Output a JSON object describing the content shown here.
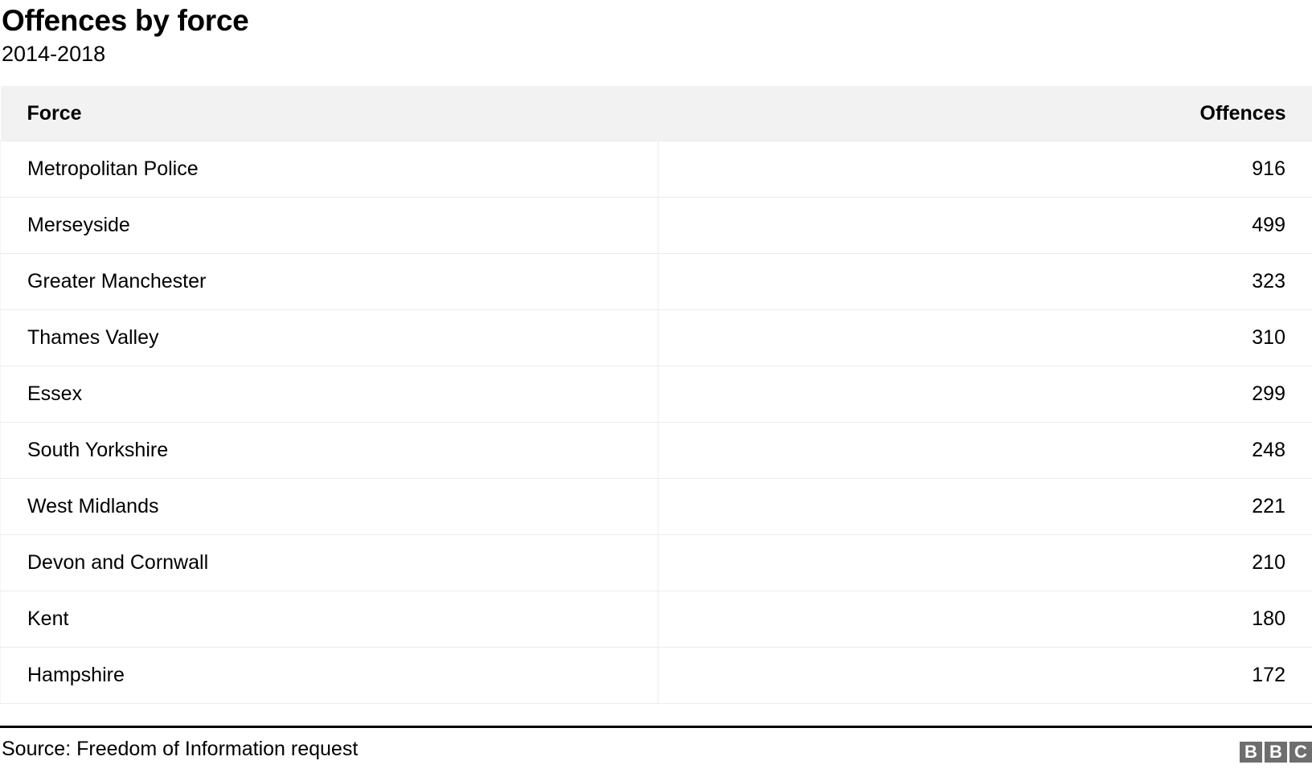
{
  "header": {
    "title": "Offences by force",
    "subtitle": "2014-2018"
  },
  "table": {
    "columns": [
      "Force",
      "Offences"
    ],
    "rows": [
      {
        "force": "Metropolitan Police",
        "offences": "916"
      },
      {
        "force": "Merseyside",
        "offences": "499"
      },
      {
        "force": "Greater Manchester",
        "offences": "323"
      },
      {
        "force": "Thames Valley",
        "offences": "310"
      },
      {
        "force": "Essex",
        "offences": "299"
      },
      {
        "force": "South Yorkshire",
        "offences": "248"
      },
      {
        "force": "West Midlands",
        "offences": "221"
      },
      {
        "force": "Devon and Cornwall",
        "offences": "210"
      },
      {
        "force": "Kent",
        "offences": "180"
      },
      {
        "force": "Hampshire",
        "offences": "172"
      }
    ]
  },
  "footer": {
    "source": "Source: Freedom of Information request",
    "logo_letters": [
      "B",
      "B",
      "C"
    ]
  },
  "chart_data": {
    "type": "table",
    "title": "Offences by force",
    "subtitle": "2014-2018",
    "columns": [
      "Force",
      "Offences"
    ],
    "categories": [
      "Metropolitan Police",
      "Merseyside",
      "Greater Manchester",
      "Thames Valley",
      "Essex",
      "South Yorkshire",
      "West Midlands",
      "Devon and Cornwall",
      "Kent",
      "Hampshire"
    ],
    "values": [
      916,
      499,
      323,
      310,
      299,
      248,
      221,
      210,
      180,
      172
    ],
    "xlabel": "Force",
    "ylabel": "Offences",
    "source": "Source: Freedom of Information request"
  },
  "colors": {
    "header_bg": "#f2f2f2",
    "row_border": "#ececec",
    "footer_rule": "#000000",
    "logo_bg": "#6e6e6e",
    "text": "#000000"
  }
}
